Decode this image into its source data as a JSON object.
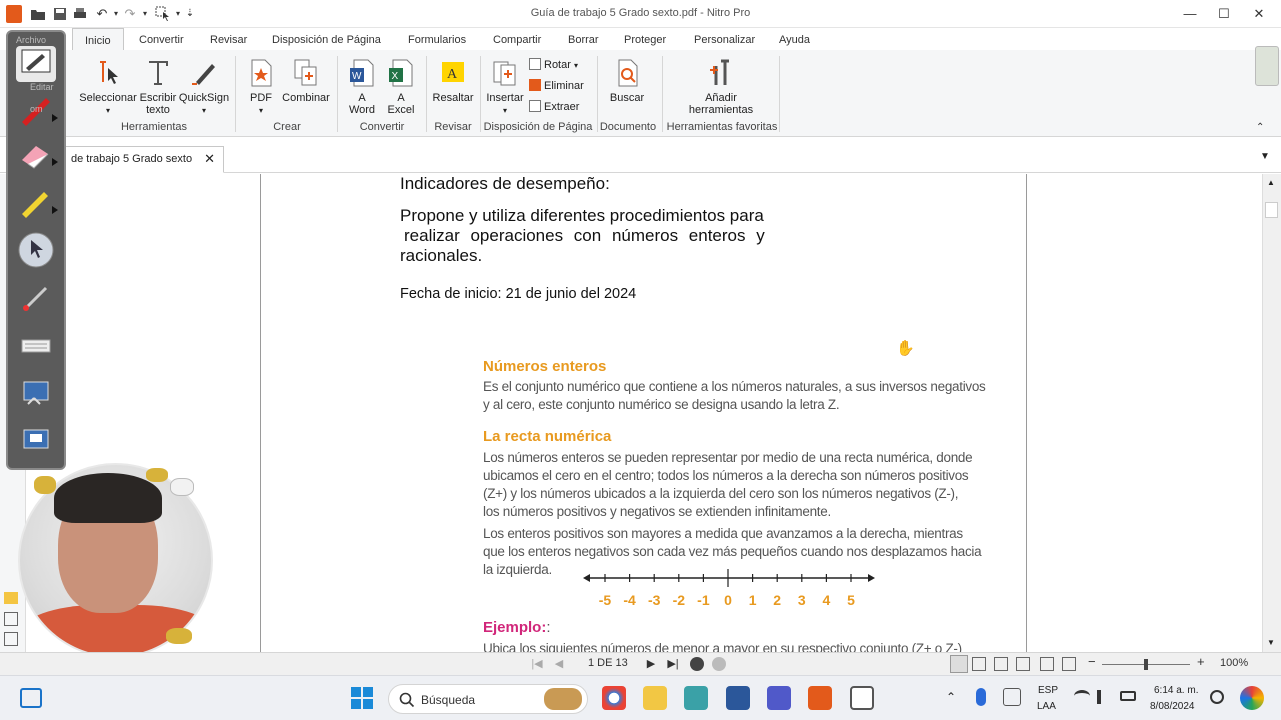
{
  "window": {
    "title": "Guía de trabajo 5 Grado sexto.pdf - Nitro Pro"
  },
  "ribbon_tabs": [
    "Inicio",
    "Convertir",
    "Revisar",
    "Disposición de Página",
    "Formularios",
    "Compartir",
    "Borrar",
    "Proteger",
    "Personalizar",
    "Ayuda"
  ],
  "ribbon": {
    "herramientas": {
      "label": "Herramientas",
      "seleccionar": "Seleccionar",
      "escribir1": "Escribir",
      "escribir2": "texto",
      "quicksign": "QuickSign"
    },
    "crear": {
      "label": "Crear",
      "pdf": "PDF",
      "combinar": "Combinar"
    },
    "convertir": {
      "label": "Convertir",
      "a1": "A",
      "word": "Word",
      "a2": "A",
      "excel": "Excel"
    },
    "revisar": {
      "label": "Revisar",
      "resaltar": "Resaltar"
    },
    "disposicion": {
      "label": "Disposición de Página",
      "insertar": "Insertar",
      "rotar": "Rotar",
      "eliminar": "Eliminar",
      "extraer": "Extraer"
    },
    "documento": {
      "label": "Documento",
      "buscar": "Buscar"
    },
    "favoritas": {
      "label": "Herramientas favoritas",
      "anadir1": "Añadir",
      "anadir2": "herramientas"
    }
  },
  "doc_tab": {
    "label": "de trabajo 5 Grado sexto",
    "close": "✕"
  },
  "left_overlay": {
    "archivo": "Archivo",
    "editar": "Editar",
    "zoom": "om"
  },
  "document": {
    "indicadores": "Indicadores de desempeño:",
    "propone1": "Propone y utiliza diferentes procedimientos para",
    "propone2": "realizar operaciones con números enteros y",
    "propone3": "racionales.",
    "fecha": "Fecha de inicio: 21 de junio del 2024",
    "numeros_enteros_title": "Números enteros",
    "numeros_enteros_p1": "Es el conjunto numérico que contiene a los números naturales, a sus inversos negativos",
    "numeros_enteros_p2": "y al cero, este conjunto numérico se designa usando la letra Z.",
    "recta_title": "La recta numérica",
    "recta_p1_1": "Los números enteros se pueden representar por medio de una recta numérica, donde",
    "recta_p1_2": "ubicamos el cero en el centro; todos los números a la derecha son números positivos",
    "recta_p1_3": "(Z+) y los números ubicados a la izquierda del cero son los números negativos (Z-),",
    "recta_p1_4": "los números positivos y negativos se extienden infinitamente.",
    "recta_p2_1": "Los enteros positivos son mayores a medida que avanzamos a la derecha, mientras",
    "recta_p2_2": "que los enteros negativos son cada vez más pequeños cuando nos desplazamos hacia",
    "recta_p2_3": "la izquierda.",
    "number_line": [
      "-5",
      "-4",
      "-3",
      "-2",
      "-1",
      "0",
      "1",
      "2",
      "3",
      "4",
      "5"
    ],
    "ejemplo": "Ejemplo:",
    "ejemplo_colon": ":",
    "ejemplo_text": "Ubica los siguientes números de menor a mayor en su respectivo conjunto (Z+ o Z-)"
  },
  "statusbar": {
    "page": "1 DE 13",
    "zoom": "100%",
    "minus": "−",
    "plus": "+"
  },
  "taskbar": {
    "search": "Búsqueda",
    "lang1": "ESP",
    "lang2": "LAA",
    "time": "6:14 a. m.",
    "date": "8/08/2024"
  },
  "colors": {
    "section_orange": "#e89a20",
    "ejemplo_pink": "#d1267a",
    "nitro_orange": "#e35a1b"
  }
}
